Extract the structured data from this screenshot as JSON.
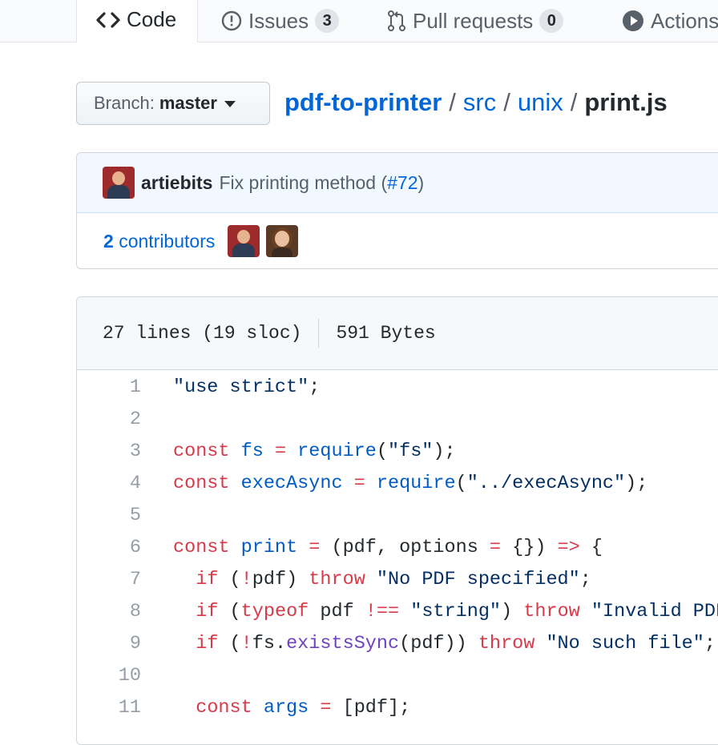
{
  "tabs": [
    {
      "label": "Code"
    },
    {
      "label": "Issues",
      "count": "3"
    },
    {
      "label": "Pull requests",
      "count": "0"
    },
    {
      "label": "Actions"
    }
  ],
  "branch": {
    "label": "Branch:",
    "name": "master"
  },
  "breadcrumb": {
    "repo": "pdf-to-printer",
    "dir1": "src",
    "dir2": "unix",
    "file": "print.js",
    "separator": "/"
  },
  "commit": {
    "author": "artiebits",
    "message": "Fix printing method (",
    "link": "#72",
    "message_end": ")"
  },
  "contributors": {
    "count": "2",
    "label": "contributors"
  },
  "file_info": {
    "lines": "27 lines (19 sloc)",
    "size": "591 Bytes"
  },
  "code": [
    {
      "n": "1",
      "t": [
        [
          "s",
          "\"use strict\""
        ],
        [
          "p",
          ";"
        ]
      ]
    },
    {
      "n": "2",
      "t": []
    },
    {
      "n": "3",
      "t": [
        [
          "k",
          "const "
        ],
        [
          "c",
          "fs"
        ],
        [
          "p",
          " "
        ],
        [
          "k",
          "="
        ],
        [
          "p",
          " "
        ],
        [
          "c",
          "require"
        ],
        [
          "p",
          "("
        ],
        [
          "s",
          "\"fs\""
        ],
        [
          "p",
          ");"
        ]
      ]
    },
    {
      "n": "4",
      "t": [
        [
          "k",
          "const "
        ],
        [
          "c",
          "execAsync"
        ],
        [
          "p",
          " "
        ],
        [
          "k",
          "="
        ],
        [
          "p",
          " "
        ],
        [
          "c",
          "require"
        ],
        [
          "p",
          "("
        ],
        [
          "s",
          "\"../execAsync\""
        ],
        [
          "p",
          ");"
        ]
      ]
    },
    {
      "n": "5",
      "t": []
    },
    {
      "n": "6",
      "t": [
        [
          "k",
          "const "
        ],
        [
          "c",
          "print"
        ],
        [
          "p",
          " "
        ],
        [
          "k",
          "="
        ],
        [
          "p",
          " (pdf, options "
        ],
        [
          "k",
          "="
        ],
        [
          "p",
          " {}) "
        ],
        [
          "k",
          "=>"
        ],
        [
          "p",
          " {"
        ]
      ]
    },
    {
      "n": "7",
      "t": [
        [
          "p",
          "  "
        ],
        [
          "k",
          "if"
        ],
        [
          "p",
          " ("
        ],
        [
          "k",
          "!"
        ],
        [
          "p",
          "pdf) "
        ],
        [
          "k",
          "throw"
        ],
        [
          "p",
          " "
        ],
        [
          "s",
          "\"No PDF specified\""
        ],
        [
          "p",
          ";"
        ]
      ]
    },
    {
      "n": "8",
      "t": [
        [
          "p",
          "  "
        ],
        [
          "k",
          "if"
        ],
        [
          "p",
          " ("
        ],
        [
          "k",
          "typeof"
        ],
        [
          "p",
          " pdf "
        ],
        [
          "k",
          "!=="
        ],
        [
          "p",
          " "
        ],
        [
          "s",
          "\"string\""
        ],
        [
          "p",
          ") "
        ],
        [
          "k",
          "throw"
        ],
        [
          "p",
          " "
        ],
        [
          "s",
          "\"Invalid PDF name\""
        ],
        [
          "p",
          ";"
        ]
      ]
    },
    {
      "n": "9",
      "t": [
        [
          "p",
          "  "
        ],
        [
          "k",
          "if"
        ],
        [
          "p",
          " ("
        ],
        [
          "k",
          "!"
        ],
        [
          "p",
          "fs."
        ],
        [
          "f",
          "existsSync"
        ],
        [
          "p",
          "(pdf)) "
        ],
        [
          "k",
          "throw"
        ],
        [
          "p",
          " "
        ],
        [
          "s",
          "\"No such file\""
        ],
        [
          "p",
          ";"
        ]
      ]
    },
    {
      "n": "10",
      "t": []
    },
    {
      "n": "11",
      "t": [
        [
          "p",
          "  "
        ],
        [
          "k",
          "const "
        ],
        [
          "c",
          "args"
        ],
        [
          "p",
          " "
        ],
        [
          "k",
          "="
        ],
        [
          "p",
          " [pdf];"
        ]
      ]
    }
  ]
}
